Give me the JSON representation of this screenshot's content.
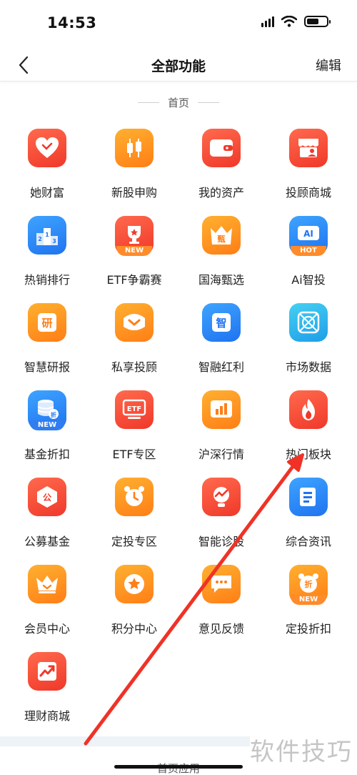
{
  "status_bar": {
    "time": "14:53"
  },
  "nav": {
    "title": "全部功能",
    "edit_label": "编辑"
  },
  "section": {
    "title": "首页"
  },
  "next_section": {
    "title": "首页应用"
  },
  "watermark": {
    "text": "软件技巧"
  },
  "colors": {
    "red": "#f0382a",
    "orange": "#ff7e16",
    "blue": "#1f73f0",
    "arrow": "#f03226"
  },
  "items": [
    {
      "label": "她财富",
      "icon": "heart-icon"
    },
    {
      "label": "新股申购",
      "icon": "candlestick-icon"
    },
    {
      "label": "我的资产",
      "icon": "wallet-icon"
    },
    {
      "label": "投顾商城",
      "icon": "advisor-shop-icon"
    },
    {
      "label": "热销排行",
      "icon": "podium-icon"
    },
    {
      "label": "ETF争霸赛",
      "icon": "trophy-icon",
      "badge": "NEW"
    },
    {
      "label": "国海甄选",
      "icon": "crown-zhen-icon",
      "glyph": "甄"
    },
    {
      "label": "Ai智投",
      "icon": "ai-icon",
      "glyph": "AI",
      "badge": "HOT"
    },
    {
      "label": "智慧研报",
      "icon": "research-icon",
      "glyph": "研"
    },
    {
      "label": "私享投顾",
      "icon": "chat-chevron-icon"
    },
    {
      "label": "智融红利",
      "icon": "zhi-icon",
      "glyph": "智"
    },
    {
      "label": "市场数据",
      "icon": "data-icon"
    },
    {
      "label": "基金折扣",
      "icon": "fund-stack-icon",
      "glyph": "折",
      "badge": "NEW"
    },
    {
      "label": "ETF专区",
      "icon": "etf-icon",
      "glyph": "ETF"
    },
    {
      "label": "沪深行情",
      "icon": "bar-chart-icon"
    },
    {
      "label": "热门板块",
      "icon": "flame-icon"
    },
    {
      "label": "公募基金",
      "icon": "gong-icon",
      "glyph": "公"
    },
    {
      "label": "定投专区",
      "icon": "alarm-clock-icon"
    },
    {
      "label": "智能诊股",
      "icon": "diagnosis-icon"
    },
    {
      "label": "综合资讯",
      "icon": "news-icon"
    },
    {
      "label": "会员中心",
      "icon": "crown-icon"
    },
    {
      "label": "积分中心",
      "icon": "star-icon"
    },
    {
      "label": "意见反馈",
      "icon": "feedback-icon"
    },
    {
      "label": "定投折扣",
      "icon": "alarm-discount-icon",
      "glyph": "折",
      "badge": "NEW"
    },
    {
      "label": "理财商城",
      "icon": "trend-up-icon"
    }
  ]
}
